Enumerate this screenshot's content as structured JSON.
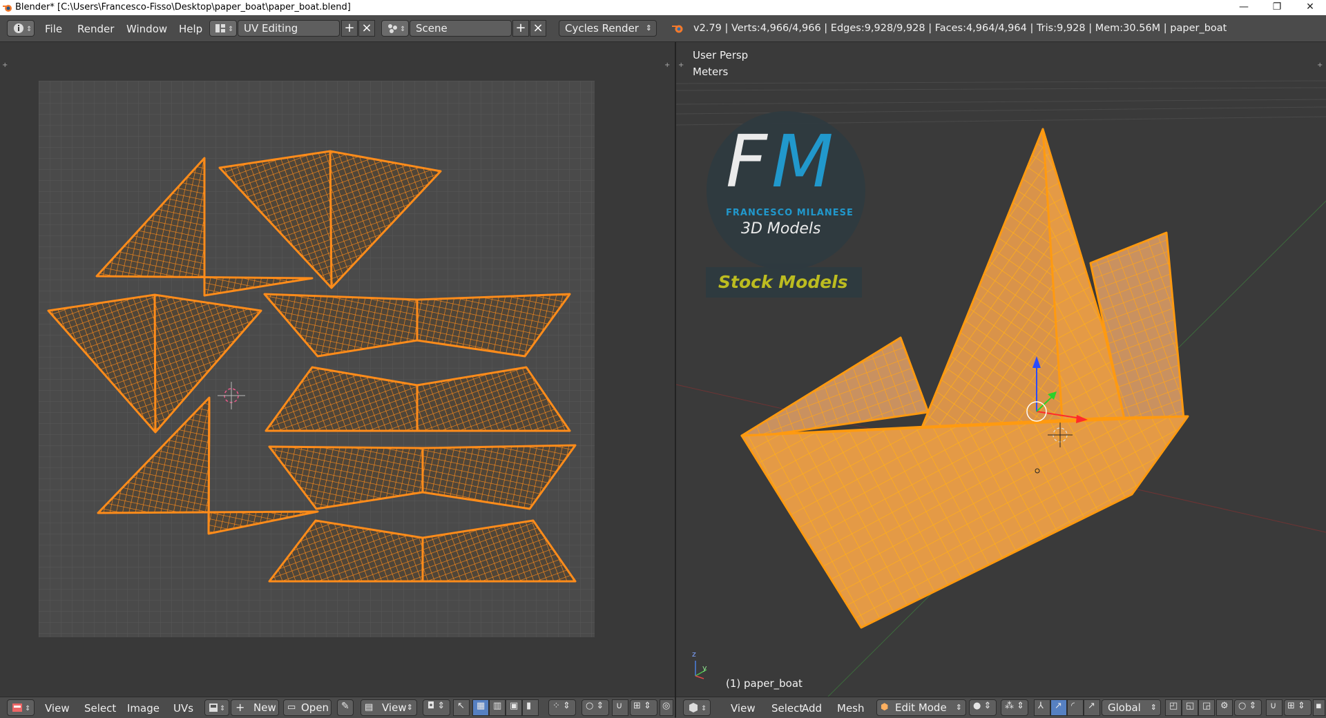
{
  "window": {
    "title": "Blender* [C:\\Users\\Francesco-Fisso\\Desktop\\paper_boat\\paper_boat.blend]",
    "minimize": "—",
    "maximize": "❐",
    "close": "✕"
  },
  "header": {
    "menus": [
      "File",
      "Render",
      "Window",
      "Help"
    ],
    "screen_layout": "UV Editing",
    "scene": "Scene",
    "render_engine": "Cycles Render",
    "stats": "v2.79 | Verts:4,966/4,966 | Edges:9,928/9,928 | Faces:4,964/4,964 | Tris:9,928 | Mem:30.56M | paper_boat"
  },
  "uv_editor": {
    "menus": [
      "View",
      "Select",
      "Image",
      "UVs"
    ],
    "new_label": "New",
    "open_label": "Open",
    "view_label": "View"
  },
  "viewport": {
    "view_name": "User Persp",
    "units": "Meters",
    "object_label": "(1) paper_boat",
    "menus": [
      "View",
      "Select",
      "Add",
      "Mesh"
    ],
    "mode": "Edit Mode",
    "orientation": "Global",
    "axis_y": "y",
    "axis_z": "z"
  },
  "watermark": {
    "logo_letters_f": "F",
    "logo_letters_m": "M",
    "author": "FRANCESCO MILANESE",
    "subtitle": "3D Models",
    "tagline": "Stock Models"
  },
  "colors": {
    "mesh": "#ff8c1a",
    "mesh_fill": "#e08a2e",
    "background": "#393939",
    "header": "#4b4b4b",
    "logo_blue": "#1fa3dc",
    "tagline": "#c8c81e"
  }
}
